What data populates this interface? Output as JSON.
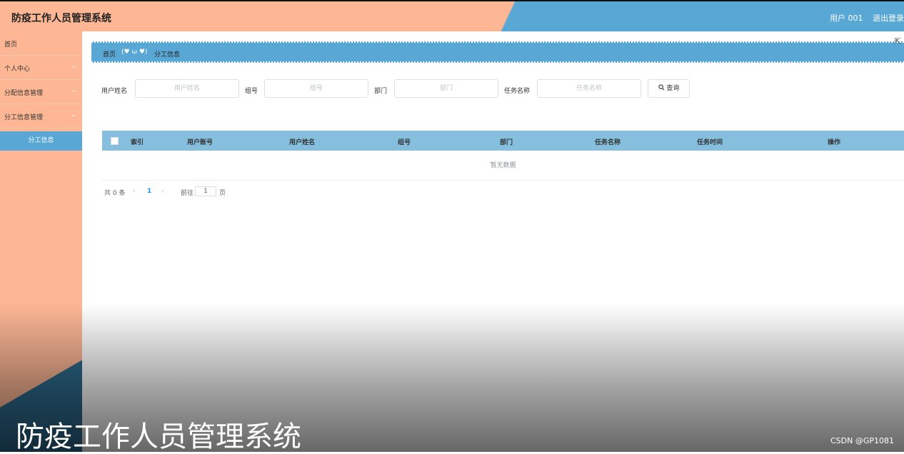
{
  "header": {
    "title": "防疫工作人员管理系统",
    "user": "用户 001",
    "logout": "退出登录"
  },
  "sidebar": {
    "items": [
      {
        "label": "首页",
        "chevron": ""
      },
      {
        "label": "个人中心",
        "chevron": "⌄"
      },
      {
        "label": "分配信息管理",
        "chevron": "⌄"
      },
      {
        "label": "分工信息管理",
        "chevron": "⌄"
      }
    ],
    "active_sub": "分工信息"
  },
  "breadcrumb": {
    "home": "首页",
    "separator": "(♥ ω ♥)",
    "current": "分工信息"
  },
  "search": {
    "fields": [
      {
        "label": "用户姓名",
        "placeholder": "用户姓名"
      },
      {
        "label": "组号",
        "placeholder": "组号"
      },
      {
        "label": "部门",
        "placeholder": "部门"
      },
      {
        "label": "任务名称",
        "placeholder": "任务名称"
      }
    ],
    "button": "查询",
    "button_icon": "search-icon"
  },
  "table": {
    "columns": [
      "索引",
      "用户账号",
      "用户姓名",
      "组号",
      "部门",
      "任务名称",
      "任务时间",
      "操作"
    ],
    "empty_text": "暂无数据"
  },
  "pagination": {
    "total": "共 0 条",
    "current_page": "1",
    "goto_label": "前往",
    "goto_value": "1",
    "page_suffix": "页"
  },
  "overlay": {
    "title": "防疫工作人员管理系统",
    "watermark": "CSDN @GP1081"
  },
  "colors": {
    "salmon": "#fdb795",
    "blue": "#58a7d4",
    "table_header": "#86bede"
  }
}
